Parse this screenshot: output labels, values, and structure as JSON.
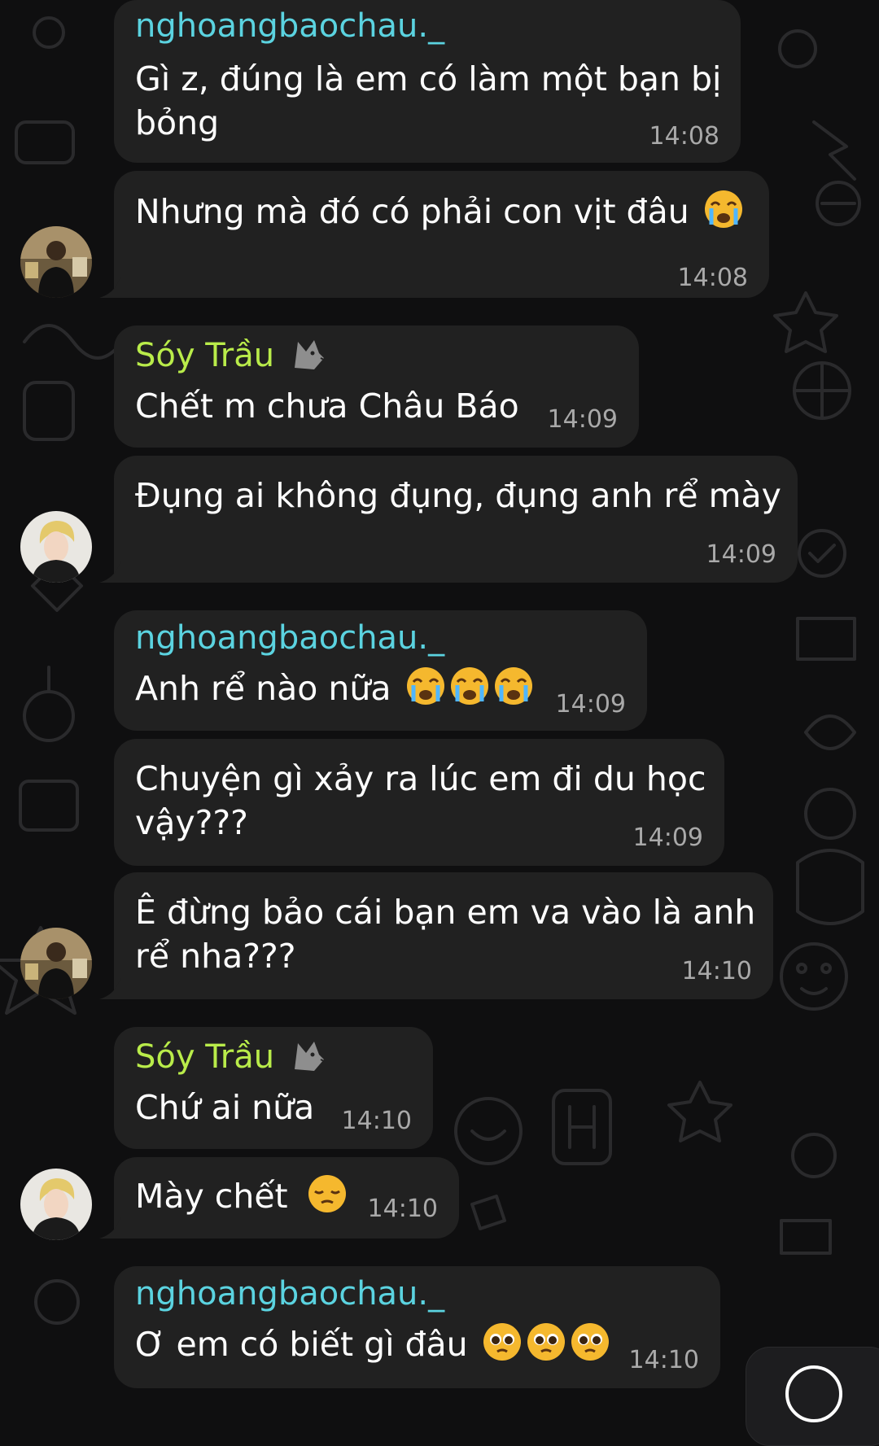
{
  "messages": [
    {
      "sender": "nghoangbaochau._",
      "text": [
        "Gì z, đúng là em có làm một bạn bị",
        "bỏng"
      ],
      "time": "14:08"
    },
    {
      "text": [
        "Nhưng mà đó có phải con vịt đâu"
      ],
      "emoji": [
        "crying-face"
      ],
      "time": "14:08"
    },
    {
      "sender": "Sóy Trầu",
      "sender_emoji": "wolf",
      "text": [
        "Chết m chưa Châu Báo"
      ],
      "time": "14:09"
    },
    {
      "text": [
        "Đụng ai không đụng, đụng anh rể mày"
      ],
      "time": "14:09"
    },
    {
      "sender": "nghoangbaochau._",
      "text": [
        "Anh rể nào nữa"
      ],
      "emoji": [
        "crying-face",
        "crying-face",
        "crying-face"
      ],
      "time": "14:09"
    },
    {
      "text": [
        "Chuyện gì xảy ra lúc em đi du học",
        "vậy???"
      ],
      "time": "14:09"
    },
    {
      "text": [
        "Ê đừng bảo cái bạn em va vào là anh",
        "rể nha???"
      ],
      "time": "14:10"
    },
    {
      "sender": "Sóy Trầu",
      "sender_emoji": "wolf",
      "text": [
        "Chứ ai nữa"
      ],
      "time": "14:10"
    },
    {
      "text": [
        "Mày chết"
      ],
      "emoji": [
        "pensive-face"
      ],
      "time": "14:10"
    },
    {
      "sender": "nghoangbaochau._",
      "text": [
        "Ơ em có biết gì đâu"
      ],
      "emoji": [
        "pleading-face",
        "pleading-face",
        "pleading-face"
      ],
      "time": "14:10"
    }
  ],
  "colors": {
    "bubble": "#212121",
    "sender_blue": "#5bd3e0",
    "sender_green": "#b9ec4a",
    "time": "#a9a9a9",
    "background": "#0f0f10"
  }
}
